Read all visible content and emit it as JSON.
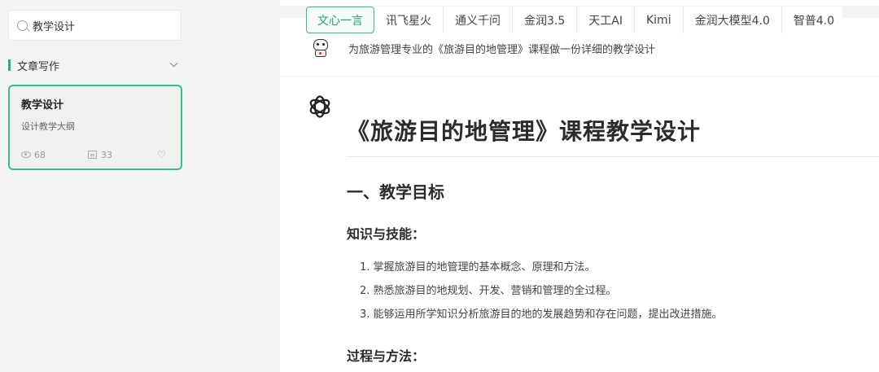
{
  "search": {
    "value": "教学设计"
  },
  "category": {
    "label": "文章写作"
  },
  "card": {
    "title": "教学设计",
    "subtitle": "设计教学大纲",
    "views": "68",
    "comments": "33"
  },
  "tabs": [
    {
      "label": "文心一言",
      "active": true
    },
    {
      "label": "讯飞星火"
    },
    {
      "label": "通义千问"
    },
    {
      "label": "金润3.5"
    },
    {
      "label": "天工AI"
    },
    {
      "label": "Kimi"
    },
    {
      "label": "金润大模型4.0"
    },
    {
      "label": "智普4.0"
    }
  ],
  "question": "为旅游管理专业的《旅游目的地管理》课程做一份详细的教学设计",
  "answer": {
    "title": "《旅游目的地管理》课程教学设计",
    "section1": "一、教学目标",
    "sub1": "知识与技能：",
    "items": [
      "1. 掌握旅游目的地管理的基本概念、原理和方法。",
      "2. 熟悉旅游目的地规划、开发、营销和管理的全过程。",
      "3. 能够运用所学知识分析旅游目的地的发展趋势和存在问题，提出改进措施。"
    ],
    "sub2": "过程与方法："
  },
  "colors": {
    "accent": "#3dba8b",
    "accent_text": "#24a36f"
  }
}
